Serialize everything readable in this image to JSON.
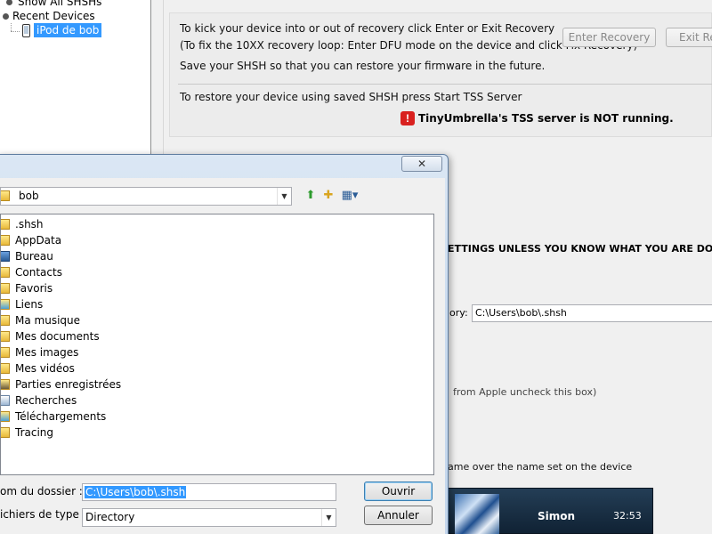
{
  "tree": {
    "show_all": "Show All SHSHs",
    "recent_devices": "Recent Devices",
    "device": "iPod de bob"
  },
  "recovery_panel": {
    "line1": "To kick your device into or out of recovery click Enter or Exit Recovery",
    "line2": "(To fix the 10XX recovery loop: Enter DFU mode on the device and click Fix Recovery)",
    "line3": "Save your SHSH so that you can restore your firmware in the future.",
    "enter_recovery": "Enter Recovery",
    "exit_recovery": "Exit Rec",
    "tss_line": "To restore your device using saved SHSH press Start TSS Server",
    "tss_status": "TinyUmbrella's TSS server is NOT running.",
    "warn_glyph": "!",
    "warning_color": "#d9211f"
  },
  "advanced": {
    "warning": "ETTINGS UNLESS YOU KNOW WHAT YOU ARE DOING!",
    "dir_label": "ory:",
    "dir_value": "C:\\Users\\bob\\.shsh",
    "apple_note": "from Apple uncheck this box)",
    "name_note": "ame over the name set on the device"
  },
  "now_playing": {
    "name": "Simon",
    "time": "32:53"
  },
  "dialog": {
    "close": "✕",
    "location": "bob",
    "combo_arrow": "▼",
    "items": [
      ".shsh",
      "AppData",
      "Bureau",
      "Contacts",
      "Favoris",
      "Liens",
      "Ma musique",
      "Mes documents",
      "Mes images",
      "Mes vidéos",
      "Parties enregistrées",
      "Recherches",
      "Téléchargements",
      "Tracing"
    ],
    "folder_name_label": "om du dossier :",
    "folder_name_value": "C:\\Users\\bob\\.shsh",
    "file_type_label": "ichiers de type :",
    "file_type_value": "Directory",
    "open": "Ouvrir",
    "cancel": "Annuler"
  }
}
